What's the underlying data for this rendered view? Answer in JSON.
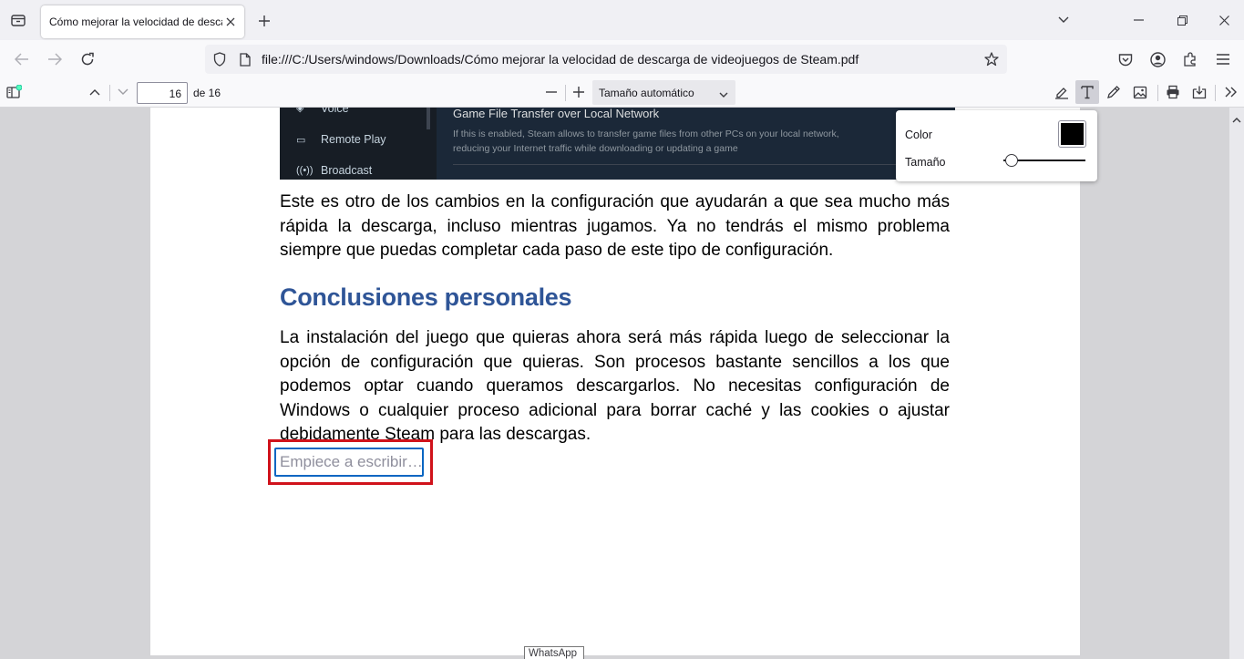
{
  "browser": {
    "tab_title": "Cómo mejorar la velocidad de descarga de videojuegos de Steam.pdf",
    "url": "file:///C:/Users/windows/Downloads/Cómo mejorar la velocidad de descarga de videojuegos de Steam.pdf"
  },
  "pdf_toolbar": {
    "page_number": "16",
    "page_count_label": "de 16",
    "zoom_label": "Tamaño automático"
  },
  "steam_screenshot": {
    "sidebar_items": [
      "Voice",
      "Remote Play",
      "Broadcast"
    ],
    "heading": "Game File Transfer over Local Network",
    "desc_line1": "If this is enabled, Steam allows to transfer game files from other PCs on your local network,",
    "desc_line2": "reducing your Internet traffic while downloading or updating a game"
  },
  "document": {
    "paragraph1": "Este es otro de los cambios en la configuración que ayudarán a que sea mucho más rápida la descarga, incluso mientras jugamos. Ya no tendrás el mismo problema siempre que puedas completar cada paso de este tipo de configuración.",
    "heading": "Conclusiones personales",
    "paragraph2": "La instalación del juego que quieras ahora será más rápida luego de seleccionar la opción de configuración que quieras. Son procesos bastante sencillos a los que podemos optar cuando queramos descargarlos. No necesitas configuración de Windows o cualquier proceso adicional para borrar caché y las cookies o ajustar debidamente Steam para las descargas.",
    "freetext_placeholder": "Empiece a escribir…"
  },
  "text_editor_popup": {
    "color_label": "Color",
    "color_value": "#000000",
    "size_label": "Tamaño",
    "size_level": 0.05
  },
  "tooltip": "WhatsApp",
  "colors": {
    "heading": "#2f5597",
    "highlight_box": "#d0121b",
    "focus_ring": "#0a66c2"
  }
}
